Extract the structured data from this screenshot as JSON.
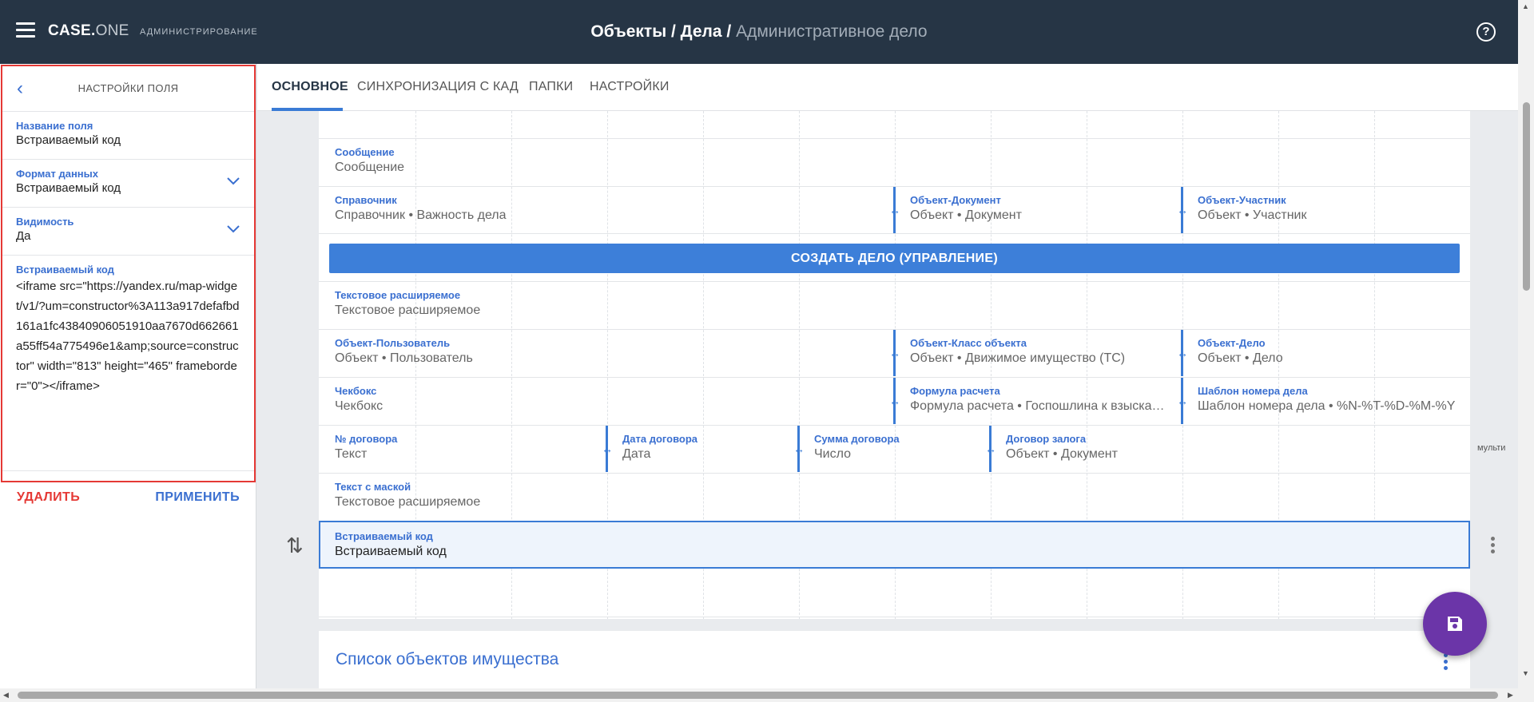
{
  "header": {
    "brand_main": "CASE.",
    "brand_accent": "ONE",
    "brand_sub": "АДМИНИСТРИРОВАНИЕ",
    "crumb_1": "Объекты / Дела /",
    "crumb_2": "Административное дело",
    "help_symbol": "?"
  },
  "field_settings": {
    "title": "НАСТРОЙКИ ПОЛЯ",
    "name_label": "Название поля",
    "name_value": "Встраиваемый код",
    "format_label": "Формат данных",
    "format_value": "Встраиваемый код",
    "visibility_label": "Видимость",
    "visibility_value": "Да",
    "code_label": "Встраиваемый код",
    "code_value": "<iframe src=\"https://yandex.ru/map-widget/v1/?um=constructor%3A113a917defafbd161a1fc43840906051910aa7670d662661a55ff54a775496e1&amp;source=constructor\" width=\"813\" height=\"465\" frameborder=\"0\"></iframe>",
    "delete_label": "УДАЛИТЬ",
    "apply_label": "ПРИМЕНИТЬ"
  },
  "tabs": [
    {
      "label": "ОСНОВНОЕ"
    },
    {
      "label": "СИНХРОНИЗАЦИЯ С КАД"
    },
    {
      "label": "ПАПКИ"
    },
    {
      "label": "НАСТРОЙКИ"
    }
  ],
  "form": {
    "message": {
      "label": "Сообщение",
      "value": "Сообщение"
    },
    "directory": {
      "label": "Справочник",
      "value": "Справочник • Важность дела"
    },
    "obj_document": {
      "label": "Объект-Документ",
      "value": "Объект • Документ"
    },
    "obj_participant": {
      "label": "Объект-Участник",
      "value": "Объект • Участник"
    },
    "create_button": "СОЗДАТЬ ДЕЛО (УПРАВЛЕНИЕ)",
    "text_expand": {
      "label": "Текстовое расширяемое",
      "value": "Текстовое расширяемое"
    },
    "obj_user": {
      "label": "Объект-Пользователь",
      "value": "Объект • Пользователь"
    },
    "obj_class": {
      "label": "Объект-Класс объекта",
      "value": "Объект • Движимое имущество (ТС)"
    },
    "obj_case": {
      "label": "Объект-Дело",
      "value": "Объект • Дело"
    },
    "checkbox": {
      "label": "Чекбокс",
      "value": "Чекбокс"
    },
    "formula": {
      "label": "Формула расчета",
      "value": "Формула расчета • Госпошлина к взыскании"
    },
    "number_template": {
      "label": "Шаблон номера дела",
      "value": "Шаблон номера дела • %N-%T-%D-%M-%Y"
    },
    "contract_no": {
      "label": "№ договора",
      "value": "Текст"
    },
    "contract_date": {
      "label": "Дата договора",
      "value": "Дата"
    },
    "contract_sum": {
      "label": "Сумма договора",
      "value": "Число"
    },
    "pledge": {
      "label": "Договор залога",
      "value": "Объект • Документ"
    },
    "masked_text": {
      "label": "Текст с маской",
      "value": "Текстовое расширяемое"
    },
    "embed": {
      "label": "Встраиваемый код",
      "value": "Встраиваемый код"
    },
    "multi_label": "мульти"
  },
  "section2": {
    "title": "Список объектов имущества"
  }
}
